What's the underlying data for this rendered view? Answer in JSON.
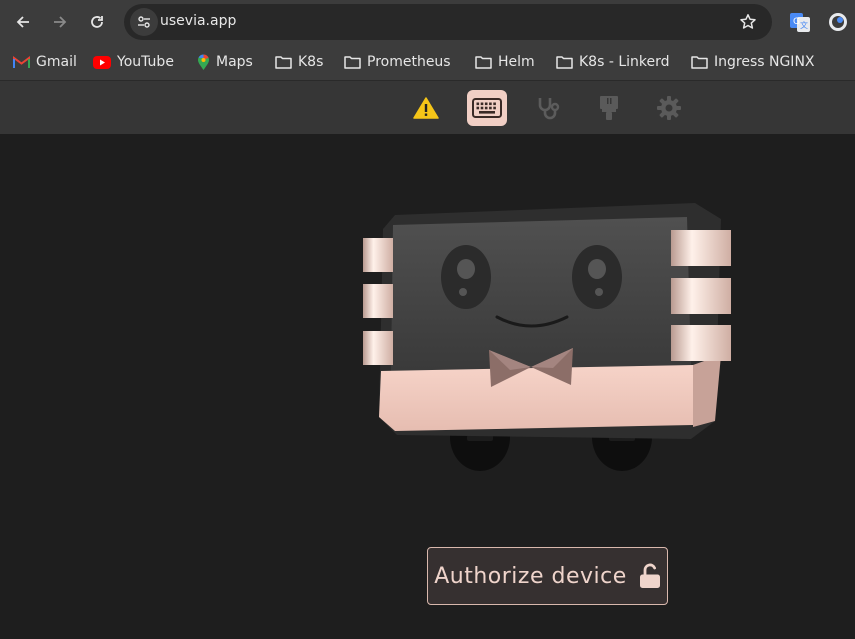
{
  "browser": {
    "url": "usevia.app",
    "nav_icons": [
      "back-arrow-icon",
      "forward-arrow-icon",
      "reload-icon"
    ],
    "extensions": [
      "google-translate-icon",
      "profile-extension-icon"
    ]
  },
  "bookmarks": [
    {
      "label": "Gmail",
      "icon": "gmail-icon"
    },
    {
      "label": "YouTube",
      "icon": "youtube-icon"
    },
    {
      "label": "Maps",
      "icon": "maps-icon"
    },
    {
      "label": "K8s",
      "icon": "folder-icon"
    },
    {
      "label": "Prometheus",
      "icon": "folder-icon"
    },
    {
      "label": "Helm",
      "icon": "folder-icon"
    },
    {
      "label": "K8s - Linkerd",
      "icon": "folder-icon"
    },
    {
      "label": "Ingress NGINX",
      "icon": "folder-icon"
    }
  ],
  "app_header": {
    "icons": [
      "warning-icon",
      "keyboard-icon",
      "stethoscope-icon",
      "paintbrush-icon",
      "gear-icon"
    ],
    "active": "keyboard-icon",
    "colors": {
      "warning": "#f5c518",
      "active_bg": "#f1cfc5",
      "inactive": "#5a5a5a"
    }
  },
  "main": {
    "authorize_label": "Authorize device",
    "authorize_icon": "unlock-icon",
    "accent": "#efd4cb"
  }
}
